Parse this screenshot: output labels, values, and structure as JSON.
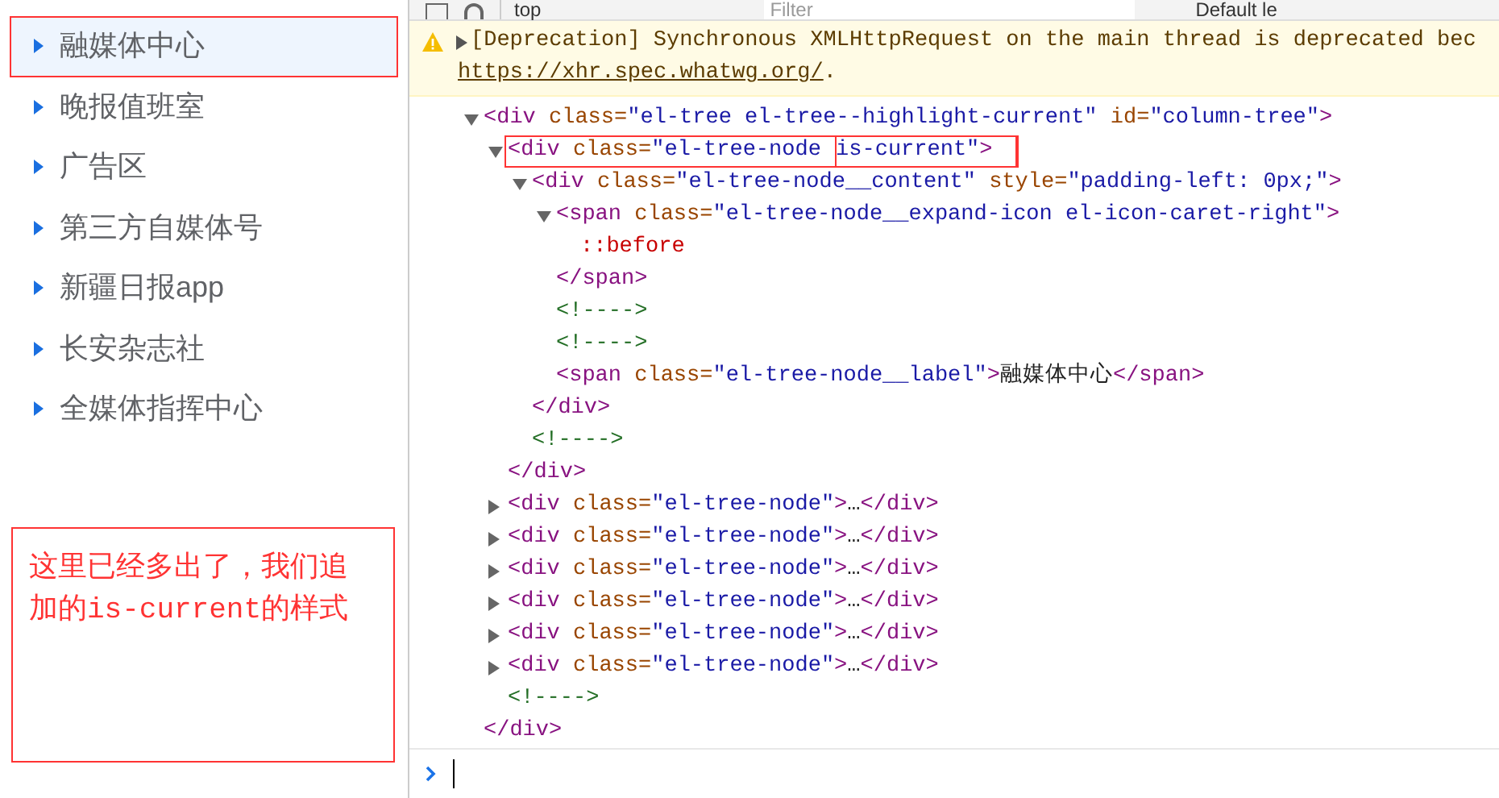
{
  "sidebar": {
    "items": [
      {
        "label": "融媒体中心",
        "selected": true,
        "annotated": true
      },
      {
        "label": "晚报值班室",
        "selected": false,
        "annotated": false
      },
      {
        "label": "广告区",
        "selected": false,
        "annotated": false
      },
      {
        "label": "第三方自媒体号",
        "selected": false,
        "annotated": false
      },
      {
        "label": "新疆日报app",
        "selected": false,
        "annotated": false
      },
      {
        "label": "长安杂志社",
        "selected": false,
        "annotated": false
      },
      {
        "label": "全媒体指挥中心",
        "selected": false,
        "annotated": false
      }
    ],
    "note": "这里已经多出了，我们追加的is-current的样式"
  },
  "toolbar": {
    "context": "top",
    "filter": {
      "placeholder": "Filter"
    },
    "levels": "Default le"
  },
  "warning": {
    "message": "[Deprecation] Synchronous XMLHttpRequest on the main thread is deprecated bec",
    "link": "https://xhr.spec.whatwg.org/",
    "after": "."
  },
  "dom_tree": [
    {
      "kind": "element",
      "expanded": true,
      "tokens": [
        {
          "kind": "tag",
          "text": "<div"
        },
        {
          "kind": "attr",
          "text": " class="
        },
        {
          "kind": "value",
          "text": "\"el-tree el-tree--highlight-current\""
        },
        {
          "kind": "attr",
          "text": " id="
        },
        {
          "kind": "value",
          "text": "\"column-tree\""
        },
        {
          "kind": "tag",
          "text": ">"
        }
      ],
      "children": [
        {
          "kind": "element",
          "expanded": true,
          "annotated": true,
          "tokens": [
            {
              "kind": "tag",
              "text": "<div"
            },
            {
              "kind": "attr",
              "text": " class="
            },
            {
              "kind": "value",
              "text": "\"el-tree-node "
            }
          ],
          "marked": [
            {
              "kind": "value",
              "text": "is-current\""
            },
            {
              "kind": "tag",
              "text": ">"
            }
          ],
          "children": [
            {
              "kind": "element",
              "expanded": true,
              "tokens": [
                {
                  "kind": "tag",
                  "text": "<div"
                },
                {
                  "kind": "attr",
                  "text": " class="
                },
                {
                  "kind": "value",
                  "text": "\"el-tree-node__content\""
                },
                {
                  "kind": "attr",
                  "text": " style="
                },
                {
                  "kind": "value",
                  "text": "\"padding-left: 0px;\""
                },
                {
                  "kind": "tag",
                  "text": ">"
                }
              ],
              "children": [
                {
                  "kind": "element",
                  "expanded": true,
                  "tokens": [
                    {
                      "kind": "tag",
                      "text": "<span"
                    },
                    {
                      "kind": "attr",
                      "text": " class="
                    },
                    {
                      "kind": "value",
                      "text": "\"el-tree-node__expand-icon el-icon-caret-right\""
                    },
                    {
                      "kind": "tag",
                      "text": ">"
                    }
                  ],
                  "children": [
                    {
                      "kind": "leaf",
                      "tokens": [
                        {
                          "kind": "pseudo",
                          "text": "::before"
                        }
                      ]
                    }
                  ],
                  "closing": [
                    {
                      "kind": "tag",
                      "text": "</span>"
                    }
                  ]
                },
                {
                  "kind": "leaf",
                  "tokens": [
                    {
                      "kind": "comment",
                      "text": "<!---->"
                    }
                  ]
                },
                {
                  "kind": "leaf",
                  "tokens": [
                    {
                      "kind": "comment",
                      "text": "<!---->"
                    }
                  ]
                },
                {
                  "kind": "leaf",
                  "tokens": [
                    {
                      "kind": "tag",
                      "text": "<span"
                    },
                    {
                      "kind": "attr",
                      "text": " class="
                    },
                    {
                      "kind": "value",
                      "text": "\"el-tree-node__label\""
                    },
                    {
                      "kind": "tag",
                      "text": ">"
                    },
                    {
                      "kind": "text",
                      "text": "融媒体中心"
                    },
                    {
                      "kind": "tag",
                      "text": "</span>"
                    }
                  ]
                }
              ],
              "closing": [
                {
                  "kind": "tag",
                  "text": "</div>"
                }
              ]
            },
            {
              "kind": "leaf",
              "tokens": [
                {
                  "kind": "comment",
                  "text": "<!---->"
                }
              ]
            }
          ],
          "closing": [
            {
              "kind": "tag",
              "text": "</div>"
            }
          ]
        },
        {
          "kind": "element",
          "expanded": false,
          "tokens": [
            {
              "kind": "tag",
              "text": "<div"
            },
            {
              "kind": "attr",
              "text": " class="
            },
            {
              "kind": "value",
              "text": "\"el-tree-node\""
            },
            {
              "kind": "tag",
              "text": ">"
            },
            {
              "kind": "text",
              "text": "…"
            },
            {
              "kind": "tag",
              "text": "</div>"
            }
          ]
        },
        {
          "kind": "element",
          "expanded": false,
          "tokens": [
            {
              "kind": "tag",
              "text": "<div"
            },
            {
              "kind": "attr",
              "text": " class="
            },
            {
              "kind": "value",
              "text": "\"el-tree-node\""
            },
            {
              "kind": "tag",
              "text": ">"
            },
            {
              "kind": "text",
              "text": "…"
            },
            {
              "kind": "tag",
              "text": "</div>"
            }
          ]
        },
        {
          "kind": "element",
          "expanded": false,
          "tokens": [
            {
              "kind": "tag",
              "text": "<div"
            },
            {
              "kind": "attr",
              "text": " class="
            },
            {
              "kind": "value",
              "text": "\"el-tree-node\""
            },
            {
              "kind": "tag",
              "text": ">"
            },
            {
              "kind": "text",
              "text": "…"
            },
            {
              "kind": "tag",
              "text": "</div>"
            }
          ]
        },
        {
          "kind": "element",
          "expanded": false,
          "tokens": [
            {
              "kind": "tag",
              "text": "<div"
            },
            {
              "kind": "attr",
              "text": " class="
            },
            {
              "kind": "value",
              "text": "\"el-tree-node\""
            },
            {
              "kind": "tag",
              "text": ">"
            },
            {
              "kind": "text",
              "text": "…"
            },
            {
              "kind": "tag",
              "text": "</div>"
            }
          ]
        },
        {
          "kind": "element",
          "expanded": false,
          "tokens": [
            {
              "kind": "tag",
              "text": "<div"
            },
            {
              "kind": "attr",
              "text": " class="
            },
            {
              "kind": "value",
              "text": "\"el-tree-node\""
            },
            {
              "kind": "tag",
              "text": ">"
            },
            {
              "kind": "text",
              "text": "…"
            },
            {
              "kind": "tag",
              "text": "</div>"
            }
          ]
        },
        {
          "kind": "element",
          "expanded": false,
          "tokens": [
            {
              "kind": "tag",
              "text": "<div"
            },
            {
              "kind": "attr",
              "text": " class="
            },
            {
              "kind": "value",
              "text": "\"el-tree-node\""
            },
            {
              "kind": "tag",
              "text": ">"
            },
            {
              "kind": "text",
              "text": "…"
            },
            {
              "kind": "tag",
              "text": "</div>"
            }
          ]
        },
        {
          "kind": "leaf",
          "tokens": [
            {
              "kind": "comment",
              "text": "<!---->"
            }
          ]
        }
      ],
      "closing": [
        {
          "kind": "tag",
          "text": "</div>"
        }
      ]
    }
  ]
}
